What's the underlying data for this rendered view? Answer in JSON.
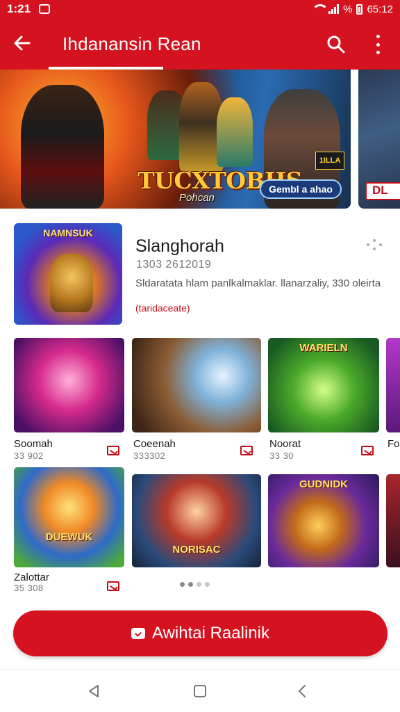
{
  "status_bar": {
    "time": "1:21",
    "battery_text": "% ",
    "clock_right": "65:12"
  },
  "app_bar": {
    "title": "Ihdanansin Rean"
  },
  "hero": {
    "logo_text": "TUCXTOBHS",
    "logo_sub": "Pohcan",
    "button_label": "Gembl a ahao",
    "corner_tag": "1ILLA",
    "next_tag": "DL"
  },
  "featured": {
    "thumb_label": "NAMNSUK",
    "title": "Slanghorah",
    "meta": "1303 2612019",
    "description": "Sldaratata hlam panlkalmaklar. llanarzaliy, 330 oleirta",
    "tag": "(taridaceate)"
  },
  "grid": [
    {
      "thumb_label": "",
      "title": "Soomah",
      "sub": "33 902"
    },
    {
      "thumb_label": "",
      "title": "Coeenah",
      "sub": "333302"
    },
    {
      "thumb_label": "WARIELN",
      "title": "Noorat",
      "sub": "33 30"
    },
    {
      "thumb_label": "",
      "title": "Fo",
      "sub": ""
    },
    {
      "thumb_label": "DUEWUK",
      "title": "Zalottar",
      "sub": "35 308"
    },
    {
      "thumb_label": "NORISAC",
      "title": "",
      "sub": ""
    },
    {
      "thumb_label": "GUDNIDK",
      "title": "",
      "sub": ""
    }
  ],
  "cta": {
    "label": "Awihtai Raalinik"
  },
  "colors": {
    "brand_red": "#d5121f",
    "text_dark": "#1b1b1b",
    "text_muted": "#777777"
  },
  "icons": [
    "back-arrow-icon",
    "search-icon",
    "more-vert-icon",
    "bookmark-icon",
    "nav-back-icon",
    "nav-home-icon",
    "nav-recents-icon"
  ]
}
